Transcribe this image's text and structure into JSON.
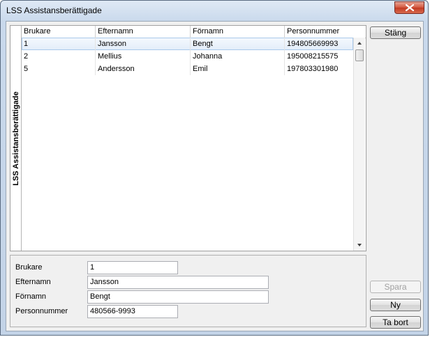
{
  "window": {
    "title": "LSS Assistansberättigade"
  },
  "grid": {
    "caption": "LSS Assistansberättigade",
    "columns": [
      "Brukare",
      "Efternamn",
      "Förnamn",
      "Personnummer"
    ],
    "rows": [
      [
        "1",
        "Jansson",
        "Bengt",
        "194805669993"
      ],
      [
        "2",
        "Mellius",
        "Johanna",
        "195008215575"
      ],
      [
        "5",
        "Andersson",
        "Emil",
        "197803301980"
      ]
    ],
    "selected_row": 0
  },
  "form": {
    "brukare_label": "Brukare",
    "brukare_value": "1",
    "efternamn_label": "Efternamn",
    "efternamn_value": "Jansson",
    "fornamn_label": "Förnamn",
    "fornamn_value": "Bengt",
    "personnummer_label": "Personnummer",
    "personnummer_value": "480566-9993"
  },
  "buttons": {
    "stang": "Stäng",
    "spara": "Spara",
    "ny": "Ny",
    "ta_bort": "Ta bort"
  },
  "icons": {
    "close": "close-icon",
    "scroll_up": "arrow-up-icon",
    "scroll_down": "arrow-down-icon"
  }
}
